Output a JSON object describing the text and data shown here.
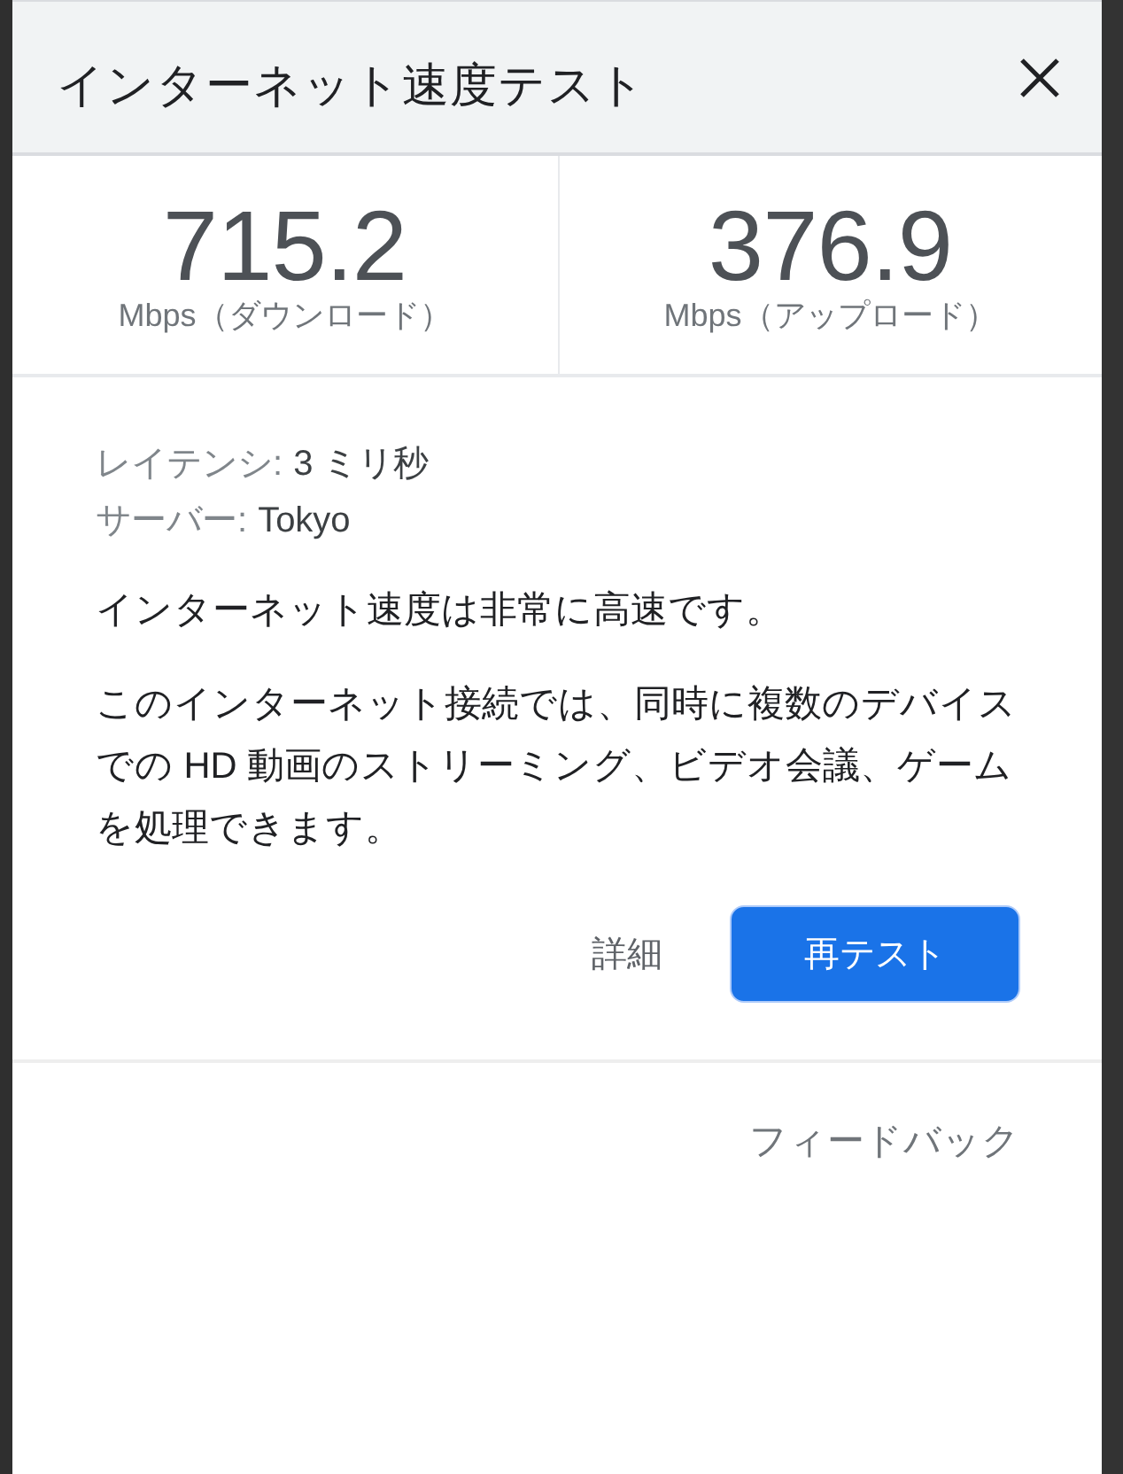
{
  "dialog": {
    "title": "インターネット速度テスト"
  },
  "results": [
    {
      "value": "715.2",
      "unit": "Mbps（ダウンロード）"
    },
    {
      "value": "376.9",
      "unit": "Mbps（アップロード）"
    }
  ],
  "details": [
    {
      "label": "レイテンシ:",
      "value": "3 ミリ秒"
    },
    {
      "label": "サーバー:",
      "value": "Tokyo"
    }
  ],
  "summary": "インターネット速度は非常に高速です。",
  "description": "このインターネット接続では、同時に複数のデバイスでの HD 動画のストリーミング、ビデオ会議、ゲームを処理できます。",
  "actions": [
    {
      "kind": "text",
      "label": "詳細"
    },
    {
      "kind": "primary",
      "label": "再テスト"
    }
  ],
  "feedback": "フィードバック"
}
